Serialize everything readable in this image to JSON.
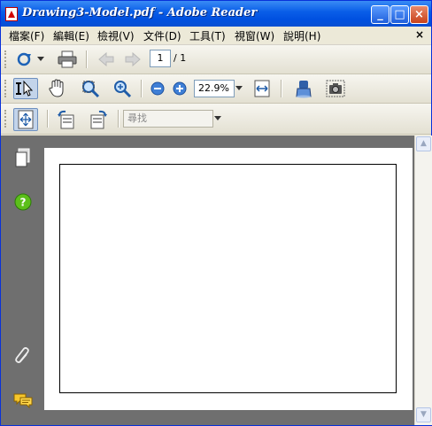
{
  "window": {
    "title": "Drawing3-Model.pdf - Adobe Reader",
    "minimize": "_",
    "maximize": "□",
    "close": "×"
  },
  "menu": {
    "items": [
      "檔案(F)",
      "編輯(E)",
      "檢視(V)",
      "文件(D)",
      "工具(T)",
      "視窗(W)",
      "說明(H)"
    ],
    "close": "×"
  },
  "toolbar1": {
    "page_current": "1",
    "page_total": "/ 1"
  },
  "toolbar2": {
    "zoom_value": "22.9%"
  },
  "toolbar3": {
    "search_placeholder": "尋找"
  },
  "colors": {
    "title_bar": "#0a5ee8",
    "chrome": "#ece9d8",
    "workspace": "#6f6f6f"
  }
}
